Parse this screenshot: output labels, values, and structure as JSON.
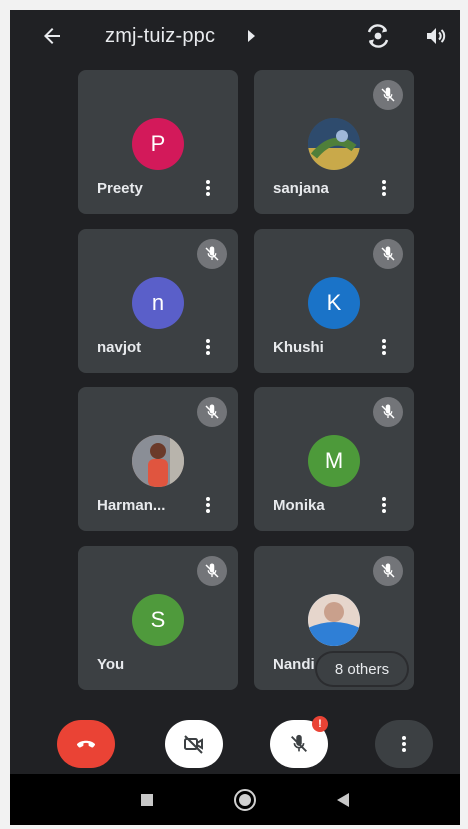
{
  "header": {
    "meeting_code": "zmj-tuiz-ppc"
  },
  "participants": [
    {
      "name": "Preety",
      "initial": "P",
      "color": "#d3195a",
      "muted": false,
      "photo": false
    },
    {
      "name": "sanjana",
      "initial": "",
      "color": "#3a5a7a",
      "muted": true,
      "photo": true
    },
    {
      "name": "navjot",
      "initial": "n",
      "color": "#5a5fc9",
      "muted": true,
      "photo": false
    },
    {
      "name": "Khushi",
      "initial": "K",
      "color": "#1a73c8",
      "muted": true,
      "photo": false
    },
    {
      "name": "Harman...",
      "initial": "",
      "color": "#c98a6a",
      "muted": true,
      "photo": true
    },
    {
      "name": "Monika",
      "initial": "M",
      "color": "#4d9a3a",
      "muted": true,
      "photo": false
    },
    {
      "name": "You",
      "initial": "S",
      "color": "#4f9a3c",
      "muted": true,
      "photo": false
    },
    {
      "name": "Nandi",
      "initial": "",
      "color": "#6aa6e0",
      "muted": true,
      "photo": true
    }
  ],
  "others_label": "8 others",
  "controls": {
    "mic_badge": "!"
  },
  "colors": {
    "background": "#202124",
    "tile": "#3c4043",
    "end_call": "#ea4335",
    "muted_badge": "#737579"
  }
}
